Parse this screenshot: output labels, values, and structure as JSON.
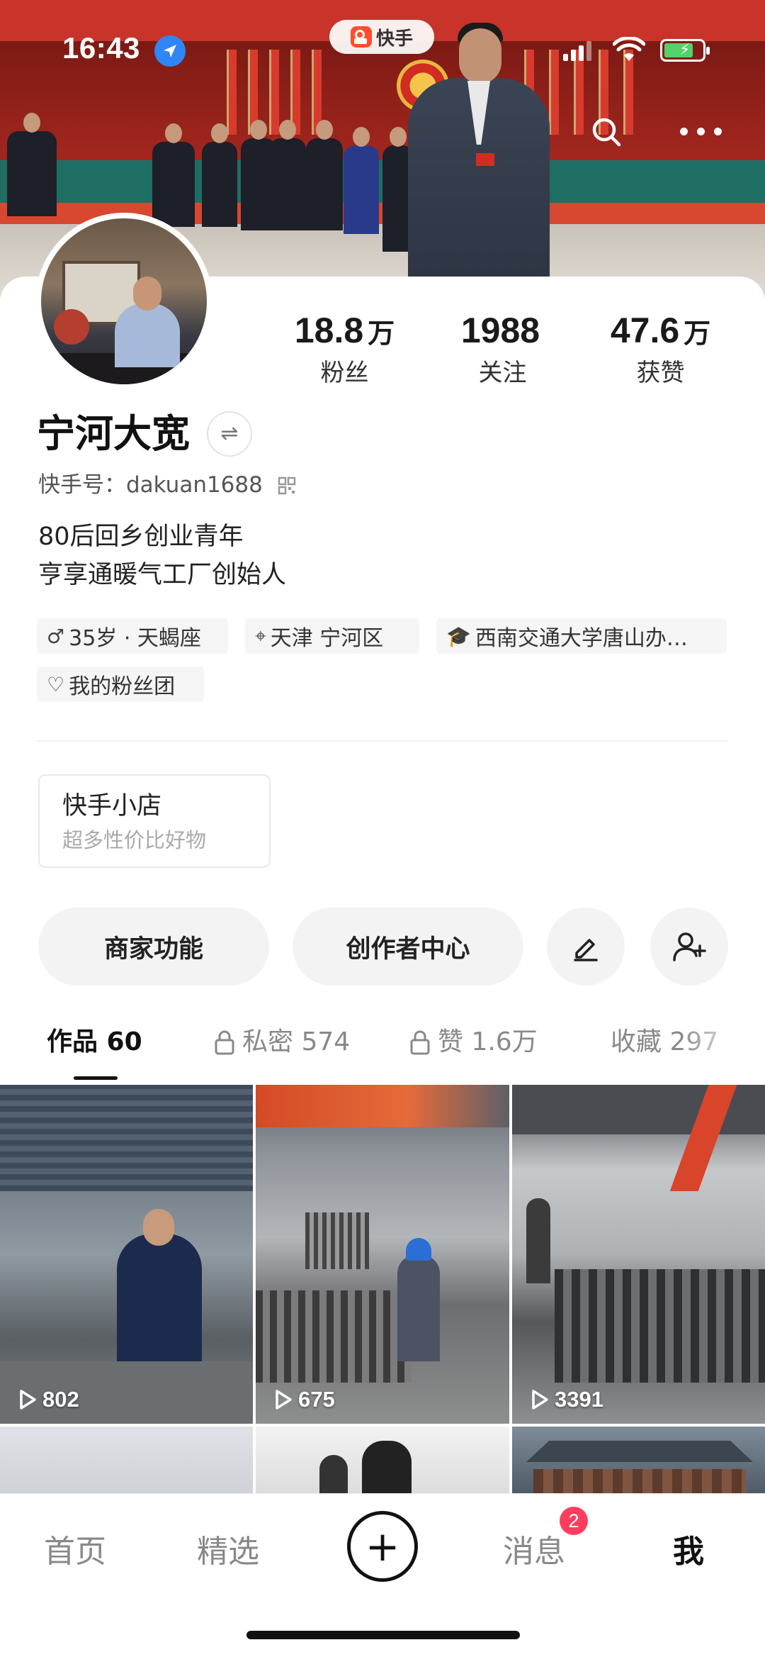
{
  "status_bar": {
    "time": "16:43"
  },
  "app_pill": {
    "label": "快手"
  },
  "profile": {
    "stats": [
      {
        "number": "18.8",
        "unit": "万",
        "label": "粉丝"
      },
      {
        "number": "1988",
        "unit": "",
        "label": "关注"
      },
      {
        "number": "47.6",
        "unit": "万",
        "label": "获赞"
      }
    ],
    "username": "宁河大宽",
    "switch_symbol": "⇌",
    "kwai_id": "快手号：dakuan1688",
    "bio_lines": [
      "80后回乡创业青年",
      "亨享通暖气工厂创始人"
    ],
    "tags": [
      {
        "icon": "♂",
        "text": "35岁 · 天蝎座"
      },
      {
        "icon": "⌖",
        "text": "天津 宁河区"
      },
      {
        "icon": "🎓",
        "text": "西南交通大学唐山办…"
      },
      {
        "icon": "♡",
        "text": "我的粉丝团"
      }
    ]
  },
  "shop": {
    "title": "快手小店",
    "subtitle": "超多性价比好物"
  },
  "actions": {
    "merchant": "商家功能",
    "creator": "创作者中心"
  },
  "tabs": [
    {
      "label": "作品 60",
      "locked": false
    },
    {
      "label": "私密 574",
      "locked": true
    },
    {
      "label": "赞 1.6万",
      "locked": true
    },
    {
      "label": "收藏 297",
      "locked": false
    }
  ],
  "videos": [
    {
      "plays": "802"
    },
    {
      "plays": "675"
    },
    {
      "plays": "3391"
    }
  ],
  "bottom_nav": {
    "home": "首页",
    "featured": "精选",
    "plus": "+",
    "messages": "消息",
    "messages_badge": "2",
    "me": "我"
  },
  "colors": {
    "badge": "#ff3e5d",
    "location_blue": "#2f86f6",
    "battery_green": "#52d26a"
  }
}
